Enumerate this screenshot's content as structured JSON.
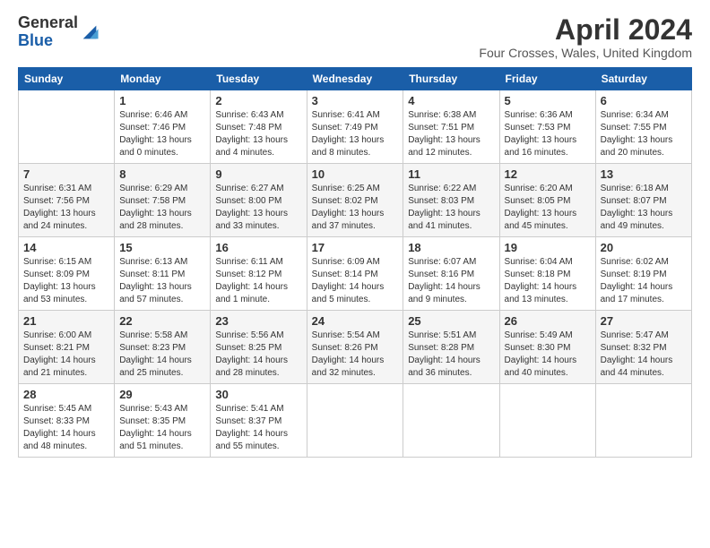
{
  "logo": {
    "general": "General",
    "blue": "Blue"
  },
  "header": {
    "title": "April 2024",
    "location": "Four Crosses, Wales, United Kingdom"
  },
  "weekdays": [
    "Sunday",
    "Monday",
    "Tuesday",
    "Wednesday",
    "Thursday",
    "Friday",
    "Saturday"
  ],
  "weeks": [
    [
      {
        "day": "",
        "sunrise": "",
        "sunset": "",
        "daylight": ""
      },
      {
        "day": "1",
        "sunrise": "Sunrise: 6:46 AM",
        "sunset": "Sunset: 7:46 PM",
        "daylight": "Daylight: 13 hours and 0 minutes."
      },
      {
        "day": "2",
        "sunrise": "Sunrise: 6:43 AM",
        "sunset": "Sunset: 7:48 PM",
        "daylight": "Daylight: 13 hours and 4 minutes."
      },
      {
        "day": "3",
        "sunrise": "Sunrise: 6:41 AM",
        "sunset": "Sunset: 7:49 PM",
        "daylight": "Daylight: 13 hours and 8 minutes."
      },
      {
        "day": "4",
        "sunrise": "Sunrise: 6:38 AM",
        "sunset": "Sunset: 7:51 PM",
        "daylight": "Daylight: 13 hours and 12 minutes."
      },
      {
        "day": "5",
        "sunrise": "Sunrise: 6:36 AM",
        "sunset": "Sunset: 7:53 PM",
        "daylight": "Daylight: 13 hours and 16 minutes."
      },
      {
        "day": "6",
        "sunrise": "Sunrise: 6:34 AM",
        "sunset": "Sunset: 7:55 PM",
        "daylight": "Daylight: 13 hours and 20 minutes."
      }
    ],
    [
      {
        "day": "7",
        "sunrise": "Sunrise: 6:31 AM",
        "sunset": "Sunset: 7:56 PM",
        "daylight": "Daylight: 13 hours and 24 minutes."
      },
      {
        "day": "8",
        "sunrise": "Sunrise: 6:29 AM",
        "sunset": "Sunset: 7:58 PM",
        "daylight": "Daylight: 13 hours and 28 minutes."
      },
      {
        "day": "9",
        "sunrise": "Sunrise: 6:27 AM",
        "sunset": "Sunset: 8:00 PM",
        "daylight": "Daylight: 13 hours and 33 minutes."
      },
      {
        "day": "10",
        "sunrise": "Sunrise: 6:25 AM",
        "sunset": "Sunset: 8:02 PM",
        "daylight": "Daylight: 13 hours and 37 minutes."
      },
      {
        "day": "11",
        "sunrise": "Sunrise: 6:22 AM",
        "sunset": "Sunset: 8:03 PM",
        "daylight": "Daylight: 13 hours and 41 minutes."
      },
      {
        "day": "12",
        "sunrise": "Sunrise: 6:20 AM",
        "sunset": "Sunset: 8:05 PM",
        "daylight": "Daylight: 13 hours and 45 minutes."
      },
      {
        "day": "13",
        "sunrise": "Sunrise: 6:18 AM",
        "sunset": "Sunset: 8:07 PM",
        "daylight": "Daylight: 13 hours and 49 minutes."
      }
    ],
    [
      {
        "day": "14",
        "sunrise": "Sunrise: 6:15 AM",
        "sunset": "Sunset: 8:09 PM",
        "daylight": "Daylight: 13 hours and 53 minutes."
      },
      {
        "day": "15",
        "sunrise": "Sunrise: 6:13 AM",
        "sunset": "Sunset: 8:11 PM",
        "daylight": "Daylight: 13 hours and 57 minutes."
      },
      {
        "day": "16",
        "sunrise": "Sunrise: 6:11 AM",
        "sunset": "Sunset: 8:12 PM",
        "daylight": "Daylight: 14 hours and 1 minute."
      },
      {
        "day": "17",
        "sunrise": "Sunrise: 6:09 AM",
        "sunset": "Sunset: 8:14 PM",
        "daylight": "Daylight: 14 hours and 5 minutes."
      },
      {
        "day": "18",
        "sunrise": "Sunrise: 6:07 AM",
        "sunset": "Sunset: 8:16 PM",
        "daylight": "Daylight: 14 hours and 9 minutes."
      },
      {
        "day": "19",
        "sunrise": "Sunrise: 6:04 AM",
        "sunset": "Sunset: 8:18 PM",
        "daylight": "Daylight: 14 hours and 13 minutes."
      },
      {
        "day": "20",
        "sunrise": "Sunrise: 6:02 AM",
        "sunset": "Sunset: 8:19 PM",
        "daylight": "Daylight: 14 hours and 17 minutes."
      }
    ],
    [
      {
        "day": "21",
        "sunrise": "Sunrise: 6:00 AM",
        "sunset": "Sunset: 8:21 PM",
        "daylight": "Daylight: 14 hours and 21 minutes."
      },
      {
        "day": "22",
        "sunrise": "Sunrise: 5:58 AM",
        "sunset": "Sunset: 8:23 PM",
        "daylight": "Daylight: 14 hours and 25 minutes."
      },
      {
        "day": "23",
        "sunrise": "Sunrise: 5:56 AM",
        "sunset": "Sunset: 8:25 PM",
        "daylight": "Daylight: 14 hours and 28 minutes."
      },
      {
        "day": "24",
        "sunrise": "Sunrise: 5:54 AM",
        "sunset": "Sunset: 8:26 PM",
        "daylight": "Daylight: 14 hours and 32 minutes."
      },
      {
        "day": "25",
        "sunrise": "Sunrise: 5:51 AM",
        "sunset": "Sunset: 8:28 PM",
        "daylight": "Daylight: 14 hours and 36 minutes."
      },
      {
        "day": "26",
        "sunrise": "Sunrise: 5:49 AM",
        "sunset": "Sunset: 8:30 PM",
        "daylight": "Daylight: 14 hours and 40 minutes."
      },
      {
        "day": "27",
        "sunrise": "Sunrise: 5:47 AM",
        "sunset": "Sunset: 8:32 PM",
        "daylight": "Daylight: 14 hours and 44 minutes."
      }
    ],
    [
      {
        "day": "28",
        "sunrise": "Sunrise: 5:45 AM",
        "sunset": "Sunset: 8:33 PM",
        "daylight": "Daylight: 14 hours and 48 minutes."
      },
      {
        "day": "29",
        "sunrise": "Sunrise: 5:43 AM",
        "sunset": "Sunset: 8:35 PM",
        "daylight": "Daylight: 14 hours and 51 minutes."
      },
      {
        "day": "30",
        "sunrise": "Sunrise: 5:41 AM",
        "sunset": "Sunset: 8:37 PM",
        "daylight": "Daylight: 14 hours and 55 minutes."
      },
      {
        "day": "",
        "sunrise": "",
        "sunset": "",
        "daylight": ""
      },
      {
        "day": "",
        "sunrise": "",
        "sunset": "",
        "daylight": ""
      },
      {
        "day": "",
        "sunrise": "",
        "sunset": "",
        "daylight": ""
      },
      {
        "day": "",
        "sunrise": "",
        "sunset": "",
        "daylight": ""
      }
    ]
  ]
}
